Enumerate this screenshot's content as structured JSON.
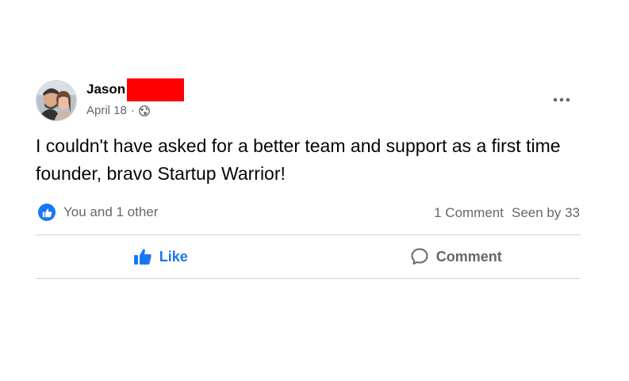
{
  "post": {
    "author": "Jason",
    "date": "April 18",
    "separator": "·",
    "audience_icon": "globe-icon",
    "message": "I couldn't have asked for a better team and support as a first time founder, bravo Startup Warrior!",
    "reactions_text": "You and 1 other",
    "comment_count": "1 Comment",
    "seen_by": "Seen by 33"
  },
  "actions": {
    "like_label": "Like",
    "comment_label": "Comment"
  },
  "colors": {
    "accent": "#1877f2",
    "secondary_text": "#65676b",
    "redaction": "#ff0000"
  }
}
